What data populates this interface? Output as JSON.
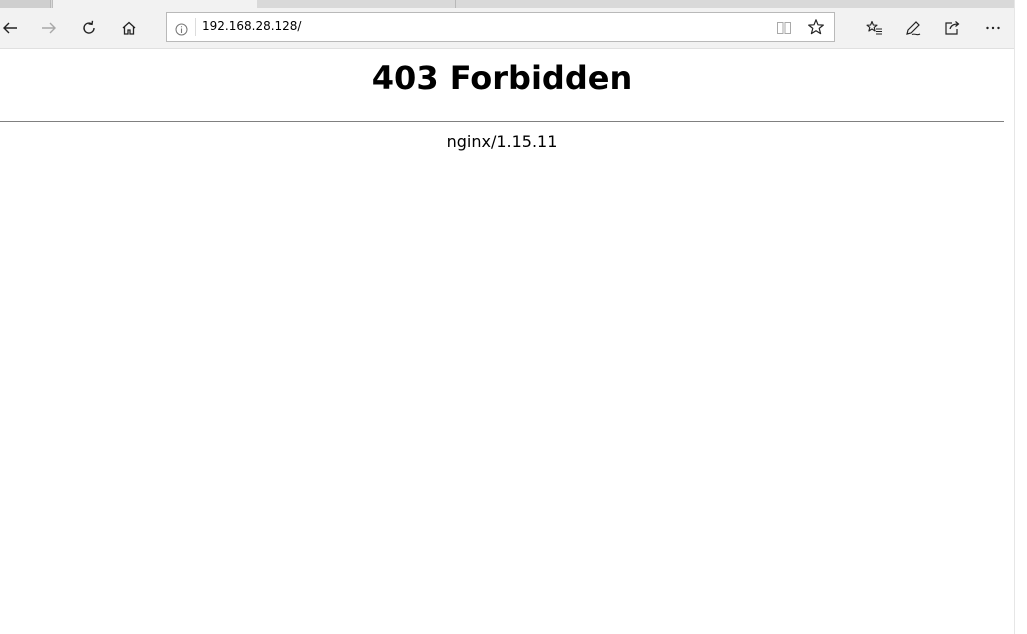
{
  "browser": {
    "url": "192.168.28.128/",
    "toolbar_icons": {
      "back": "back-arrow-icon",
      "forward": "forward-arrow-icon",
      "refresh": "refresh-icon",
      "home": "home-icon",
      "site_info": "info-icon",
      "reading_view": "reading-view-icon",
      "favorite": "star-icon",
      "favorites_hub": "favorites-list-icon",
      "notes": "pen-icon",
      "share": "share-icon",
      "more": "more-dots-icon"
    },
    "forward_enabled": false
  },
  "page": {
    "title": "403 Forbidden",
    "server": "nginx/1.15.11"
  },
  "colors": {
    "toolbar_bg": "#f2f2f2",
    "tabstrip_bg": "#d9d9d9",
    "rule": "#808080",
    "text": "#000000"
  }
}
